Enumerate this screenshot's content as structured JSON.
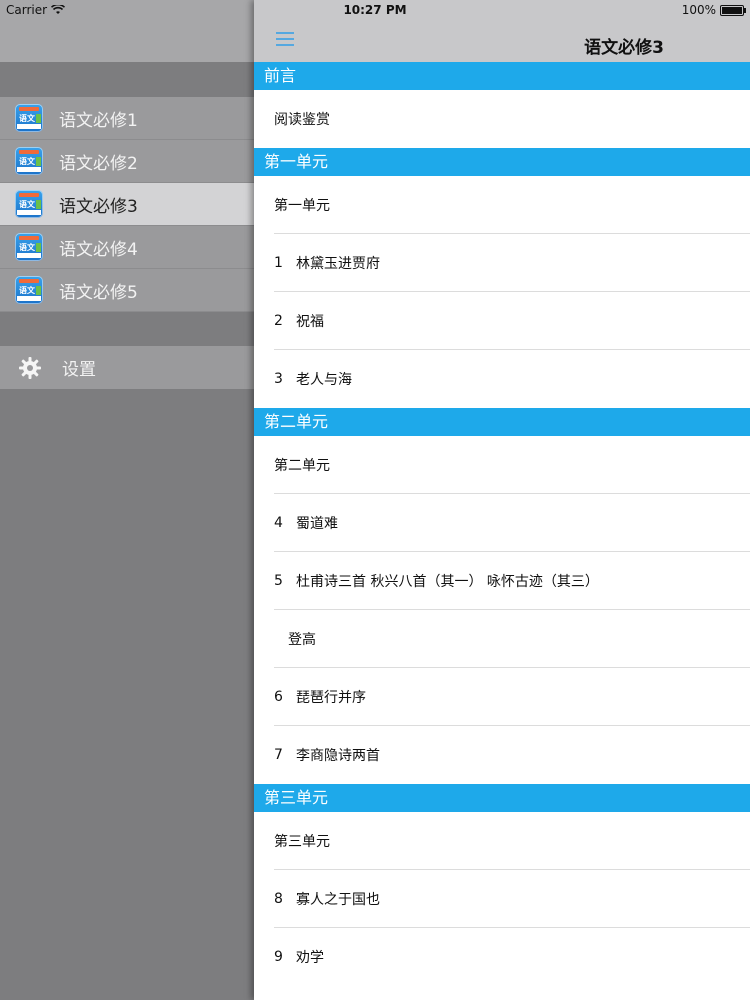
{
  "status_bar": {
    "carrier": "Carrier",
    "time": "10:27 PM",
    "battery": "100%",
    "battery_level": 1.0
  },
  "sidebar": {
    "items": [
      {
        "label": "语文必修1",
        "icon": "book-icon"
      },
      {
        "label": "语文必修2",
        "icon": "book-icon"
      },
      {
        "label": "语文必修3",
        "icon": "book-icon",
        "selected": true
      },
      {
        "label": "语文必修4",
        "icon": "book-icon"
      },
      {
        "label": "语文必修5",
        "icon": "book-icon"
      }
    ],
    "settings_label": "设置",
    "icon_badge_text": "语文"
  },
  "navbar": {
    "title": "语文必修3",
    "menu_icon": "hamburger-icon"
  },
  "sections": [
    {
      "header": "前言",
      "rows": [
        {
          "num": "",
          "label": "阅读鉴赏"
        }
      ]
    },
    {
      "header": "第一单元",
      "rows": [
        {
          "num": "",
          "label": "第一单元"
        },
        {
          "num": "1",
          "label": "林黛玉进贾府"
        },
        {
          "num": "2",
          "label": "祝福"
        },
        {
          "num": "3",
          "label": "老人与海"
        }
      ]
    },
    {
      "header": "第二单元",
      "rows": [
        {
          "num": "",
          "label": "第二单元"
        },
        {
          "num": "4",
          "label": "蜀道难"
        },
        {
          "num": "5",
          "label": "杜甫诗三首 秋兴八首（其一） 咏怀古迹（其三）"
        },
        {
          "num": "",
          "label": "登高",
          "indent": true
        },
        {
          "num": "6",
          "label": "琵琶行并序"
        },
        {
          "num": "7",
          "label": "李商隐诗两首"
        }
      ]
    },
    {
      "header": "第三单元",
      "rows": [
        {
          "num": "",
          "label": "第三单元"
        },
        {
          "num": "8",
          "label": "寡人之于国也"
        },
        {
          "num": "9",
          "label": "劝学"
        }
      ]
    }
  ],
  "colors": {
    "section_header": "#1ea9ea",
    "selected_item": "#d3d3d5",
    "sidebar": "#7d7d7f"
  }
}
